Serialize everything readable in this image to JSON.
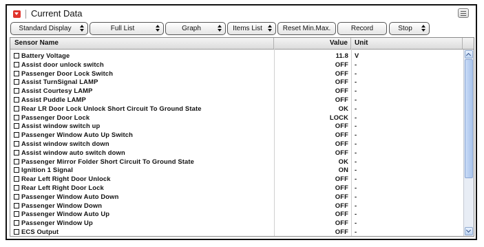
{
  "window": {
    "title": "Current Data"
  },
  "toolbar": {
    "display_select": "Standard Display",
    "list_select": "Full List",
    "graph_select": "Graph",
    "items_select": "Items List",
    "reset_button": "Reset Min.Max.",
    "record_button": "Record",
    "stop_select": "Stop"
  },
  "table": {
    "headers": {
      "name": "Sensor Name",
      "value": "Value",
      "unit": "Unit"
    },
    "rows": [
      {
        "name": "Battery Voltage",
        "value": "11.8",
        "unit": "V"
      },
      {
        "name": "Assist door unlock switch",
        "value": "OFF",
        "unit": "-"
      },
      {
        "name": "Passenger Door Lock Switch",
        "value": "OFF",
        "unit": "-"
      },
      {
        "name": "Assist TurnSignal LAMP",
        "value": "OFF",
        "unit": "-"
      },
      {
        "name": "Assist Courtesy LAMP",
        "value": "OFF",
        "unit": "-"
      },
      {
        "name": "Assist Puddle LAMP",
        "value": "OFF",
        "unit": "-"
      },
      {
        "name": "Rear LR Door Lock Unlock Short Circuit To Ground State",
        "value": "OK",
        "unit": "-"
      },
      {
        "name": "Passenger Door Lock",
        "value": "LOCK",
        "unit": "-"
      },
      {
        "name": "Assist window switch up",
        "value": "OFF",
        "unit": "-"
      },
      {
        "name": "Passenger Window Auto Up Switch",
        "value": "OFF",
        "unit": "-"
      },
      {
        "name": "Assist window switch down",
        "value": "OFF",
        "unit": "-"
      },
      {
        "name": "Assist window auto switch down",
        "value": "OFF",
        "unit": "-"
      },
      {
        "name": "Passenger Mirror Folder Short Circuit To Ground State",
        "value": "OK",
        "unit": "-"
      },
      {
        "name": "Ignition 1 Signal",
        "value": "ON",
        "unit": "-"
      },
      {
        "name": "Rear Left Right Door Unlock",
        "value": "OFF",
        "unit": "-"
      },
      {
        "name": "Rear Left Right Door Lock",
        "value": "OFF",
        "unit": "-"
      },
      {
        "name": "Passenger Window Auto Down",
        "value": "OFF",
        "unit": "-"
      },
      {
        "name": "Passenger Window Down",
        "value": "OFF",
        "unit": "-"
      },
      {
        "name": "Passenger Window Auto Up",
        "value": "OFF",
        "unit": "-"
      },
      {
        "name": "Passenger Window Up",
        "value": "OFF",
        "unit": "-"
      },
      {
        "name": "ECS Output",
        "value": "OFF",
        "unit": "-"
      }
    ]
  },
  "icons": {
    "title": "collapse-arrow-icon",
    "menu": "list-menu-icon",
    "row_checkbox": "checkbox-icon",
    "scroll_up": "chevron-up-icon",
    "scroll_down": "chevron-down-icon"
  },
  "colors": {
    "title_icon": "#e0342c",
    "scrollbar": "#bcd2f0"
  }
}
